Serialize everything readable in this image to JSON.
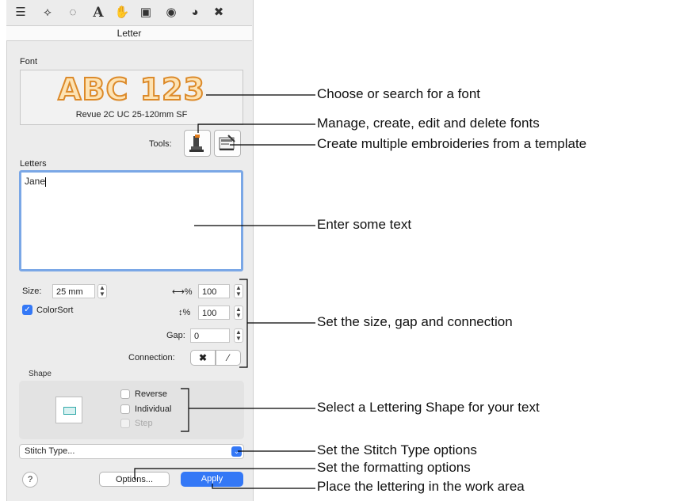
{
  "toolbar": {
    "icons": [
      "object-list-icon",
      "reshape-icon",
      "dotted-select-icon",
      "letter-icon",
      "hand-icon",
      "frame-icon",
      "circle-fill-icon",
      "pie-icon",
      "scissors-icon"
    ]
  },
  "panel": {
    "title": "Letter",
    "font_label": "Font",
    "font_sample": "ABC 123",
    "font_name": "Revue 2C UC 25-120mm SF",
    "tools_label": "Tools:",
    "letters_label": "Letters",
    "letters_value": "Jane",
    "size_label": "Size:",
    "size_value": "25 mm",
    "colorsort_label": "ColorSort",
    "width_label": "⟷%",
    "width_value": "100",
    "height_label": "↕%",
    "height_value": "100",
    "gap_label": "Gap:",
    "gap_value": "0",
    "connection_label": "Connection:",
    "shape_label": "Shape",
    "reverse_label": "Reverse",
    "individual_label": "Individual",
    "step_label": "Step",
    "stitch_type_label": "Stitch Type...",
    "help_label": "?",
    "options_label": "Options...",
    "apply_label": "Apply"
  },
  "callouts": {
    "font": "Choose or search for a font",
    "manage": "Manage, create, edit and delete fonts",
    "template": "Create multiple embroideries from a template",
    "text": "Enter some text",
    "size": "Set the size, gap and connection",
    "shape": "Select a Lettering Shape for your text",
    "stitch": "Set the Stitch Type options",
    "formatting": "Set the formatting options",
    "place": "Place the lettering in the work area"
  },
  "colors": {
    "accent": "#3478f6",
    "focus_ring": "#7aa7e6",
    "font_stroke": "#dc8a2a",
    "font_fill": "#fde3b4"
  }
}
